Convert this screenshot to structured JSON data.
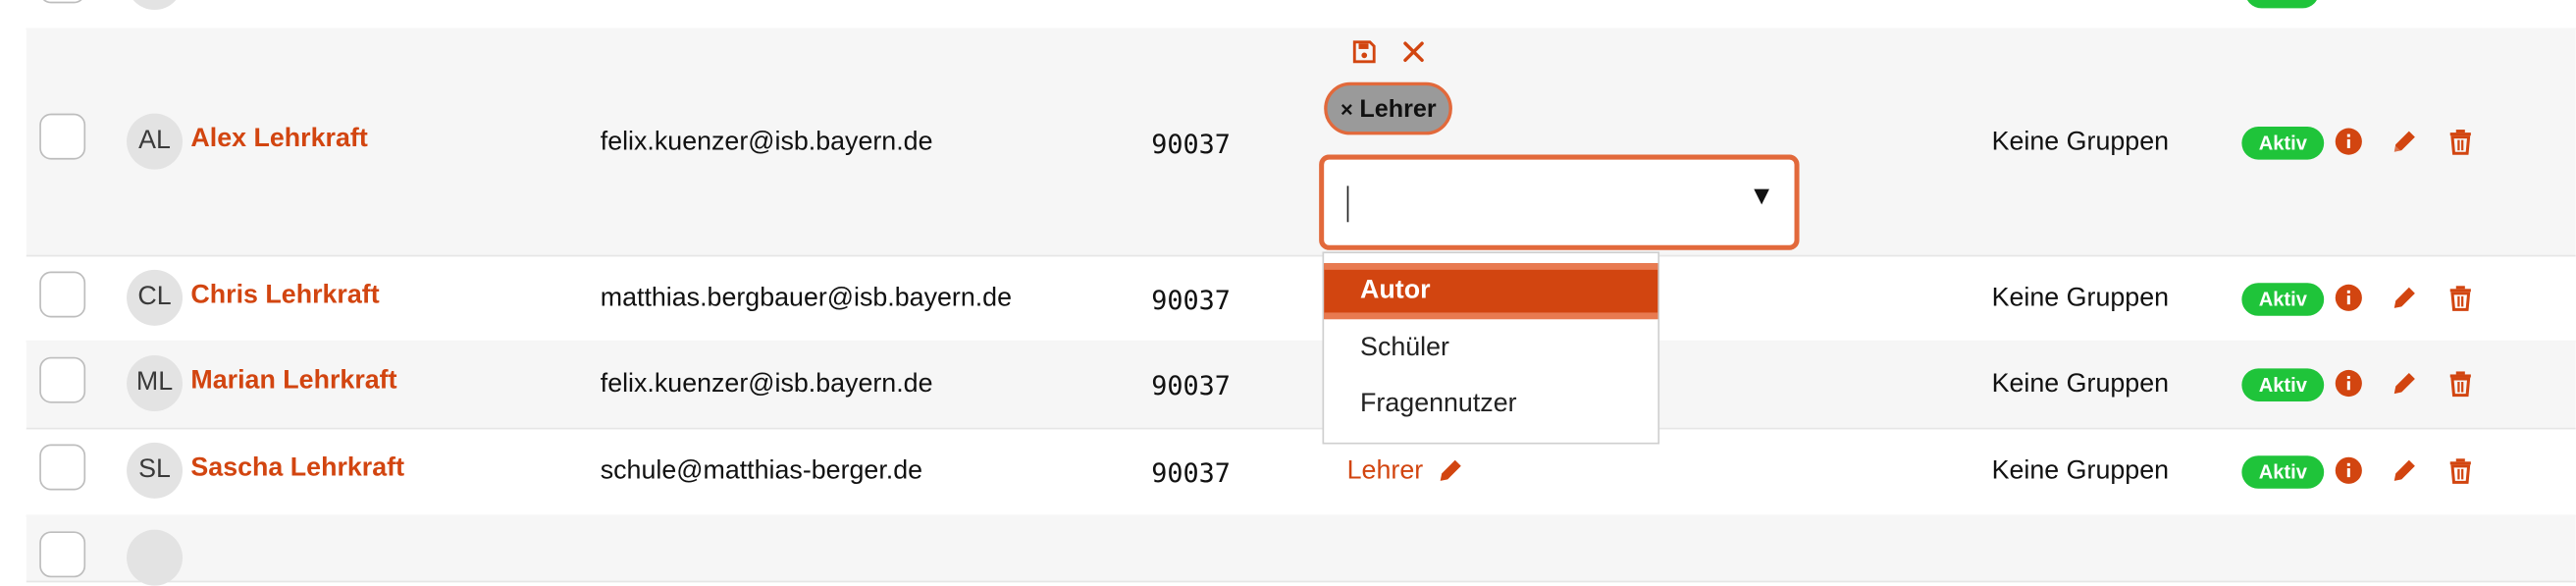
{
  "colors": {
    "accent": "#d24510",
    "active_badge": "#1fc43a",
    "focus_border": "#e2693b"
  },
  "rows": [
    {
      "initials": "AL",
      "name": "Alex Lehrkraft",
      "email": "felix.kuenzer@isb.bayern.de",
      "number": "90037",
      "groups": "Keine Gruppen",
      "status": "Aktiv"
    },
    {
      "initials": "CL",
      "name": "Chris Lehrkraft",
      "email": "matthias.bergbauer@isb.bayern.de",
      "number": "90037",
      "groups": "Keine Gruppen",
      "status": "Aktiv"
    },
    {
      "initials": "ML",
      "name": "Marian Lehrkraft",
      "email": "felix.kuenzer@isb.bayern.de",
      "number": "90037",
      "groups": "Keine Gruppen",
      "status": "Aktiv"
    },
    {
      "initials": "SL",
      "name": "Sascha Lehrkraft",
      "email": "schule@matthias-berger.de",
      "number": "90037",
      "groups": "Keine Gruppen",
      "status": "Aktiv",
      "role": "Lehrer"
    }
  ],
  "editor": {
    "selected_chip": "Lehrer",
    "chip_remove": "×",
    "input_value": "",
    "dropdown_arrow": "▼",
    "options": [
      "Autor",
      "Schüler",
      "Fragennutzer"
    ]
  },
  "icons": [
    "save-icon",
    "close-icon",
    "info-icon",
    "pencil-icon",
    "trash-icon"
  ]
}
